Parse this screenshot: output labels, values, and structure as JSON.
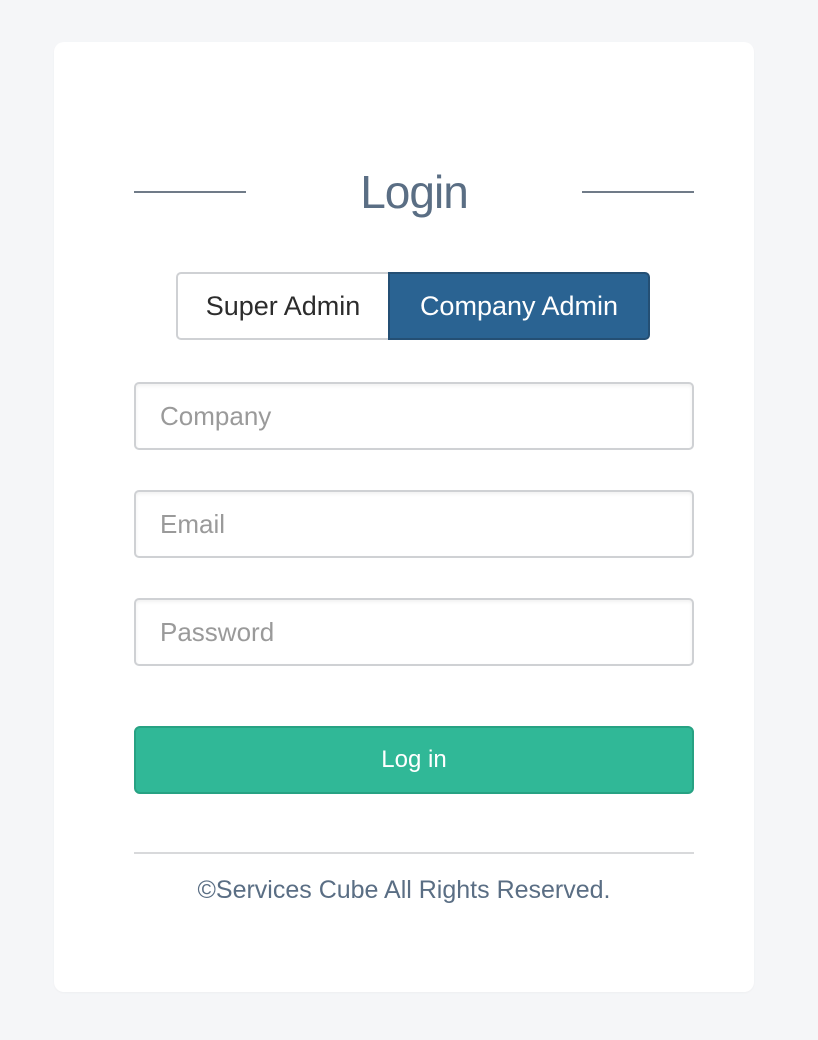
{
  "page": {
    "title": "Login"
  },
  "role_toggle": {
    "options": [
      {
        "label": "Super Admin",
        "selected": false
      },
      {
        "label": "Company Admin",
        "selected": true
      }
    ]
  },
  "form": {
    "company": {
      "placeholder": "Company",
      "value": ""
    },
    "email": {
      "placeholder": "Email",
      "value": ""
    },
    "password": {
      "placeholder": "Password",
      "value": ""
    },
    "submit_label": "Log in"
  },
  "footer": {
    "text": "©Services Cube All Rights Reserved."
  },
  "colors": {
    "background": "#f5f6f8",
    "card": "#ffffff",
    "title_text": "#5a6e84",
    "selected_toggle": "#2a6392",
    "submit_button": "#30b897",
    "field_border": "#cfd1d4"
  }
}
